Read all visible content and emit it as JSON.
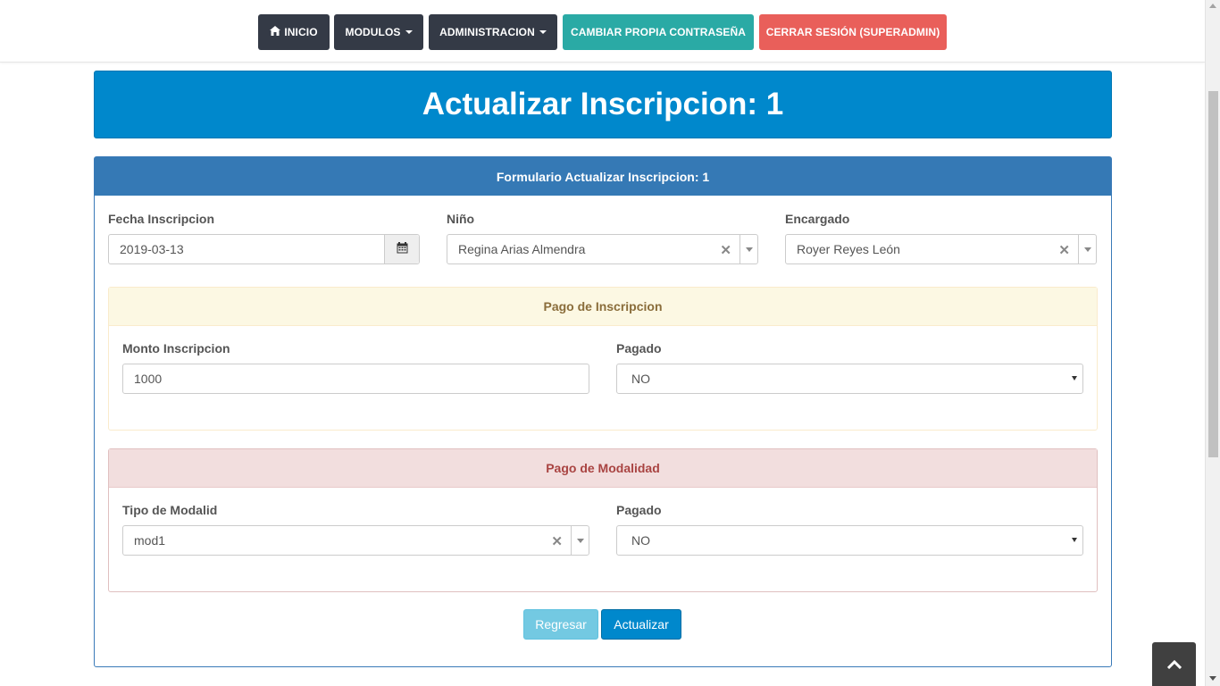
{
  "navbar": {
    "home_label": "INICIO",
    "modulos_label": "MODULOS",
    "admin_label": "ADMINISTRACION",
    "password_label": "CAMBIAR PROPIA CONTRASEÑA",
    "logout_label": "CERRAR SESIÓN (SUPERADMIN)"
  },
  "page": {
    "title": "Actualizar Inscripcion: 1"
  },
  "form": {
    "header": "Formulario Actualizar Inscripcion: 1",
    "fecha_label": "Fecha Inscripcion",
    "fecha_value": "2019-03-13",
    "nino_label": "Niño",
    "nino_value": "Regina Arias Almendra",
    "encargado_label": "Encargado",
    "encargado_value": "Royer Reyes León",
    "pago_inscripcion": {
      "title": "Pago de Inscripcion",
      "monto_label": "Monto Inscripcion",
      "monto_value": "1000",
      "pagado_label": "Pagado",
      "pagado_value": "NO"
    },
    "pago_modalidad": {
      "title": "Pago de Modalidad",
      "tipo_label": "Tipo de Modalid",
      "tipo_value": "mod1",
      "pagado_label": "Pagado",
      "pagado_value": "NO"
    },
    "back_label": "Regresar",
    "update_label": "Actualizar"
  },
  "colors": {
    "primary": "#0088cc",
    "panel_header": "#3579b5",
    "nav_dark": "#343a46",
    "nav_teal": "#2aaaa5",
    "nav_red": "#e95f5a",
    "warning_bg": "#fcf8e3",
    "danger_bg": "#f2dede"
  },
  "icons": {
    "home": "home-icon",
    "calendar": "calendar-icon",
    "clear": "clear-icon",
    "scroll_top": "chevron-up-icon"
  }
}
